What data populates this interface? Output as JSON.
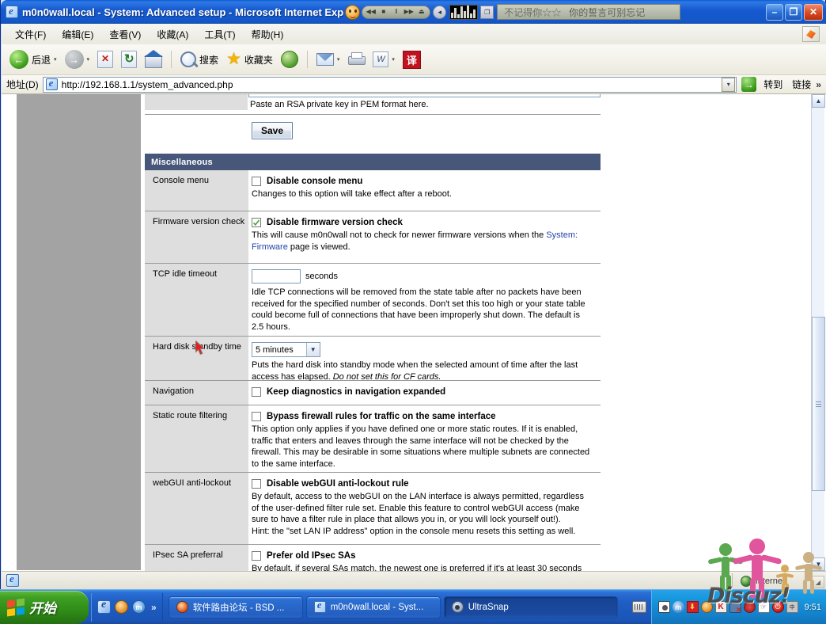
{
  "window": {
    "title": "m0n0wall.local - System: Advanced setup - Microsoft Internet Exp",
    "minimize_label": "–",
    "restore_label": "❐",
    "close_label": "✕"
  },
  "deskband": {
    "prev": "◀◀",
    "stop": "■",
    "pause": "‖",
    "next": "▶▶",
    "eject": "⏏",
    "volume": "◂",
    "mini": "❐",
    "marquee_1": "不记得你☆☆",
    "marquee_2": "你的誓言可别忘记"
  },
  "menubar": {
    "items": [
      "文件(F)",
      "编辑(E)",
      "查看(V)",
      "收藏(A)",
      "工具(T)",
      "帮助(H)"
    ]
  },
  "toolbar": {
    "back_label": "后退",
    "search_label": "搜索",
    "favorites_label": "收藏夹",
    "caret": "▾"
  },
  "address": {
    "label": "地址(D)",
    "value": "http://192.168.1.1/system_advanced.php",
    "dropdown_caret": "▾",
    "go_label": "转到",
    "go_icon": "→",
    "links_label": "链接",
    "overflow": "»"
  },
  "page": {
    "rsa_note": "Paste an RSA private key in PEM format here.",
    "save_label": "Save",
    "section_title": "Miscellaneous",
    "rows": [
      {
        "label": "Console menu",
        "control": "checkbox",
        "checked": false,
        "checkbox_label": "Disable console menu",
        "description": "Changes to this option will take effect after a reboot."
      },
      {
        "label": "Firmware version check",
        "control": "checkbox",
        "checked": true,
        "checkbox_label": "Disable firmware version check",
        "description_a": "This will cause m0n0wall not to check for newer firmware versions when the ",
        "description_link": "System: Firmware",
        "description_b": " page is viewed."
      },
      {
        "label": "TCP idle timeout",
        "control": "text",
        "value": "",
        "unit": "seconds",
        "description": "Idle TCP connections will be removed from the state table after no packets have been received for the specified number of seconds. Don't set this too high or your state table could become full of connections that have been improperly shut down. The default is 2.5 hours."
      },
      {
        "label": "Hard disk standby time",
        "control": "select",
        "selected": "5 minutes",
        "description_a": "Puts the hard disk into standby mode when the selected amount of time after the last access has elapsed. ",
        "description_italic": "Do not set this for CF cards."
      },
      {
        "label": "Navigation",
        "control": "checkbox",
        "checked": false,
        "checkbox_label": "Keep diagnostics in navigation expanded",
        "description": ""
      },
      {
        "label": "Static route filtering",
        "control": "checkbox",
        "checked": false,
        "checkbox_label": "Bypass firewall rules for traffic on the same interface",
        "description": "This option only applies if you have defined one or more static routes. If it is enabled, traffic that enters and leaves through the same interface will not be checked by the firewall. This may be desirable in some situations where multiple subnets are connected to the same interface."
      },
      {
        "label": "webGUI anti-lockout",
        "control": "checkbox",
        "checked": false,
        "checkbox_label": "Disable webGUI anti-lockout rule",
        "description": "By default, access to the webGUI on the LAN interface is always permitted, regardless of the user-defined filter rule set. Enable this feature to control webGUI access (make sure to have a filter rule in place that allows you in, or you will lock yourself out!).",
        "description2": "Hint: the \"set LAN IP address\" option in the console menu resets this setting as well."
      },
      {
        "label": "IPsec SA preferral",
        "control": "checkbox",
        "checked": false,
        "checkbox_label": "Prefer old IPsec SAs",
        "description": "By default, if several SAs match, the newest one is preferred if it's at least 30 seconds old. Select this option to always prefer old SAs over new ones."
      }
    ]
  },
  "scrollbar": {
    "up_arrow": "▲",
    "down_arrow": "▼"
  },
  "statusbar": {
    "zone_text": "Internet",
    "grip": "◢"
  },
  "watermark": {
    "text": "Discuz!"
  },
  "taskbar": {
    "start_label": "开始",
    "quicklaunch_overflow": "»",
    "quicklaunch_maxthon": "m",
    "tasks": [
      {
        "label": "软件路由论坛 - BSD ...",
        "icon": "firefox-icon",
        "active": false
      },
      {
        "label": "m0n0wall.local - Syst...",
        "icon": "ie-icon",
        "active": false
      },
      {
        "label": "UltraSnap",
        "icon": "ultrasnap-icon",
        "active": true
      }
    ],
    "tray": {
      "maxthon": "m",
      "red_badge": "⬇",
      "kaspersky": "K",
      "power": "⏻",
      "ime": "中",
      "time": "9:51"
    }
  },
  "colors": {
    "section_header_bg": "#46577a",
    "label_cell_bg": "#dedede",
    "sidebar_gray": "#a3a3a3",
    "titlebar_blue": "#1457c9",
    "taskbar_blue": "#1f5ec4",
    "start_green": "#2f8c18",
    "link_blue": "#2244aa",
    "check_green": "#3ea02c"
  }
}
